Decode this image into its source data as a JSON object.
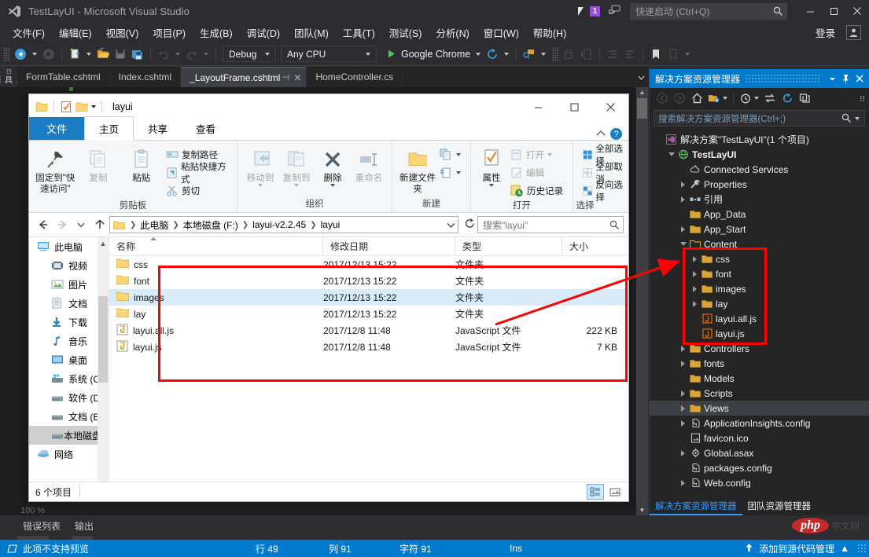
{
  "vs": {
    "title": "TestLayUI - Microsoft Visual Studio",
    "notification_count": "1",
    "quick_launch_placeholder": "快速启动 (Ctrl+Q)",
    "signin_label": "登录",
    "menus": [
      "文件(F)",
      "编辑(E)",
      "视图(V)",
      "项目(P)",
      "生成(B)",
      "调试(D)",
      "团队(M)",
      "工具(T)",
      "测试(S)",
      "分析(N)",
      "窗口(W)",
      "帮助(H)"
    ],
    "toolbar": {
      "config_combo": "Debug",
      "platform_combo": "Any CPU",
      "run_target": "Google Chrome"
    },
    "window_buttons": {
      "minimize": "—",
      "maximize": "□",
      "close": "✕"
    },
    "side_rail_label": "工具箱",
    "doc_tabs": [
      {
        "label": "FormTable.cshtml",
        "active": false
      },
      {
        "label": "Index.cshtml",
        "active": false
      },
      {
        "label": "_LayoutFrame.cshtml",
        "active": true
      },
      {
        "label": "HomeController.cs",
        "active": false
      }
    ],
    "editor_zoom": "100 %",
    "bottom_tabs": [
      "错误列表",
      "输出"
    ],
    "watermark": {
      "text": "php",
      "sub": "中文网"
    },
    "status_bar": {
      "message": "此项不支持预览",
      "line": "行 49",
      "column": "列 91",
      "chars": "字符 91",
      "insert_mode": "Ins",
      "source_control": "添加到源代码管理"
    }
  },
  "solution_explorer": {
    "title": "解决方案资源管理器",
    "search_placeholder": "搜索解决方案资源管理器(Ctrl+;)",
    "tree": [
      {
        "label": "解决方案\"TestLayUI\"(1 个项目)",
        "indent": 0,
        "icon": "solution-icon",
        "twisty": "none",
        "bold": false,
        "selected": false
      },
      {
        "label": "TestLayUI",
        "indent": 1,
        "icon": "project-web-icon",
        "twisty": "open",
        "bold": true,
        "selected": false
      },
      {
        "label": "Connected Services",
        "indent": 2,
        "icon": "cloud-icon",
        "twisty": "none",
        "bold": false,
        "selected": false
      },
      {
        "label": "Properties",
        "indent": 2,
        "icon": "wrench-icon",
        "twisty": "closed",
        "bold": false,
        "selected": false
      },
      {
        "label": "引用",
        "indent": 2,
        "icon": "references-icon",
        "twisty": "closed",
        "bold": false,
        "selected": false
      },
      {
        "label": "App_Data",
        "indent": 2,
        "icon": "folder-icon",
        "twisty": "none",
        "bold": false,
        "selected": false
      },
      {
        "label": "App_Start",
        "indent": 2,
        "icon": "folder-icon",
        "twisty": "closed",
        "bold": false,
        "selected": false
      },
      {
        "label": "Content",
        "indent": 2,
        "icon": "folder-open-icon",
        "twisty": "open",
        "bold": false,
        "selected": false
      },
      {
        "label": "css",
        "indent": 3,
        "icon": "folder-icon",
        "twisty": "closed",
        "bold": false,
        "selected": false
      },
      {
        "label": "font",
        "indent": 3,
        "icon": "folder-icon",
        "twisty": "closed",
        "bold": false,
        "selected": false
      },
      {
        "label": "images",
        "indent": 3,
        "icon": "folder-icon",
        "twisty": "closed",
        "bold": false,
        "selected": false
      },
      {
        "label": "lay",
        "indent": 3,
        "icon": "folder-icon",
        "twisty": "closed",
        "bold": false,
        "selected": false
      },
      {
        "label": "layui.all.js",
        "indent": 3,
        "icon": "js-file-icon",
        "twisty": "none",
        "bold": false,
        "selected": false
      },
      {
        "label": "layui.js",
        "indent": 3,
        "icon": "js-file-icon",
        "twisty": "none",
        "bold": false,
        "selected": false
      },
      {
        "label": "Controllers",
        "indent": 2,
        "icon": "folder-icon",
        "twisty": "closed",
        "bold": false,
        "selected": false
      },
      {
        "label": "fonts",
        "indent": 2,
        "icon": "folder-icon",
        "twisty": "closed",
        "bold": false,
        "selected": false
      },
      {
        "label": "Models",
        "indent": 2,
        "icon": "folder-icon",
        "twisty": "none",
        "bold": false,
        "selected": false
      },
      {
        "label": "Scripts",
        "indent": 2,
        "icon": "folder-icon",
        "twisty": "closed",
        "bold": false,
        "selected": false
      },
      {
        "label": "Views",
        "indent": 2,
        "icon": "folder-icon",
        "twisty": "closed",
        "bold": false,
        "selected": true
      },
      {
        "label": "ApplicationInsights.config",
        "indent": 2,
        "icon": "config-file-icon",
        "twisty": "closed",
        "bold": false,
        "selected": false
      },
      {
        "label": "favicon.ico",
        "indent": 2,
        "icon": "image-file-icon",
        "twisty": "none",
        "bold": false,
        "selected": false
      },
      {
        "label": "Global.asax",
        "indent": 2,
        "icon": "asax-file-icon",
        "twisty": "closed",
        "bold": false,
        "selected": false
      },
      {
        "label": "packages.config",
        "indent": 2,
        "icon": "config-file-icon",
        "twisty": "none",
        "bold": false,
        "selected": false
      },
      {
        "label": "Web.config",
        "indent": 2,
        "icon": "config-file-icon",
        "twisty": "closed",
        "bold": false,
        "selected": false
      }
    ],
    "footer_tabs": [
      {
        "label": "解决方案资源管理器",
        "active": true
      },
      {
        "label": "团队资源管理器",
        "active": false
      }
    ]
  },
  "explorer_window": {
    "title": "layui",
    "ribbon_tabs": [
      {
        "label": "文件",
        "kind": "file"
      },
      {
        "label": "主页",
        "kind": "active"
      },
      {
        "label": "共享",
        "kind": "normal"
      },
      {
        "label": "查看",
        "kind": "normal"
      }
    ],
    "ribbon_groups": [
      {
        "title": "剪贴板",
        "big": [
          {
            "label": "固定到\"快速访问\"",
            "icon": "pin-icon",
            "dim": false
          },
          {
            "label": "复制",
            "icon": "copy-icon",
            "dim": true
          },
          {
            "label": "粘贴",
            "icon": "paste-icon",
            "dim": false
          }
        ],
        "small": [
          {
            "label": "复制路径",
            "icon": "copy-path-icon",
            "dim": false
          },
          {
            "label": "粘贴快捷方式",
            "icon": "paste-shortcut-icon",
            "dim": false
          },
          {
            "label": "剪切",
            "icon": "scissors-icon",
            "dim": false
          }
        ]
      },
      {
        "title": "组织",
        "big": [
          {
            "label": "移动到",
            "icon": "move-to-icon",
            "dim": true
          },
          {
            "label": "复制到",
            "icon": "copy-to-icon",
            "dim": true
          },
          {
            "label": "删除",
            "icon": "delete-icon",
            "dim": false
          },
          {
            "label": "重命名",
            "icon": "rename-icon",
            "dim": true
          }
        ],
        "small": []
      },
      {
        "title": "新建",
        "big": [
          {
            "label": "新建文件夹",
            "icon": "new-folder-icon",
            "dim": false
          }
        ],
        "small": [
          {
            "label": "",
            "icon": "new-item-icon",
            "dim": false
          },
          {
            "label": "",
            "icon": "easy-access-icon",
            "dim": false
          }
        ]
      },
      {
        "title": "打开",
        "big": [
          {
            "label": "属性",
            "icon": "properties-icon",
            "dim": false
          }
        ],
        "small": [
          {
            "label": "打开",
            "icon": "open-icon",
            "dim": true
          },
          {
            "label": "编辑",
            "icon": "edit-icon",
            "dim": true
          },
          {
            "label": "历史记录",
            "icon": "history-icon",
            "dim": false
          }
        ]
      },
      {
        "title": "选择",
        "big": [],
        "small": [
          {
            "label": "全部选择",
            "icon": "select-all-icon",
            "dim": false
          },
          {
            "label": "全部取消",
            "icon": "select-none-icon",
            "dim": false
          },
          {
            "label": "反向选择",
            "icon": "invert-selection-icon",
            "dim": false
          }
        ]
      }
    ],
    "breadcrumbs": [
      "此电脑",
      "本地磁盘 (F:)",
      "layui-v2.2.45",
      "layui"
    ],
    "search_placeholder": "搜索\"layui\"",
    "nav_items": [
      {
        "label": "此电脑",
        "icon": "computer-icon",
        "indent": 0,
        "selected": false
      },
      {
        "label": "视频",
        "icon": "video-icon",
        "indent": 1,
        "selected": false
      },
      {
        "label": "图片",
        "icon": "picture-icon",
        "indent": 1,
        "selected": false
      },
      {
        "label": "文档",
        "icon": "document-icon",
        "indent": 1,
        "selected": false
      },
      {
        "label": "下载",
        "icon": "download-icon",
        "indent": 1,
        "selected": false
      },
      {
        "label": "音乐",
        "icon": "music-icon",
        "indent": 1,
        "selected": false
      },
      {
        "label": "桌面",
        "icon": "desktop-icon",
        "indent": 1,
        "selected": false
      },
      {
        "label": "系统 (C:)",
        "icon": "windows-drive-icon",
        "indent": 1,
        "selected": false
      },
      {
        "label": "软件 (D:)",
        "icon": "drive-icon",
        "indent": 1,
        "selected": false
      },
      {
        "label": "文档 (E:)",
        "icon": "drive-icon",
        "indent": 1,
        "selected": false
      },
      {
        "label": "本地磁盘 (F:)",
        "icon": "drive-icon",
        "indent": 1,
        "selected": true
      },
      {
        "label": "网络",
        "icon": "network-icon",
        "indent": 0,
        "selected": false
      }
    ],
    "columns": [
      "名称",
      "修改日期",
      "类型",
      "大小"
    ],
    "files": [
      {
        "name": "css",
        "date": "2017/12/13 15:22",
        "type": "文件夹",
        "size": "",
        "icon": "folder-icon",
        "selected": false
      },
      {
        "name": "font",
        "date": "2017/12/13 15:22",
        "type": "文件夹",
        "size": "",
        "icon": "folder-icon",
        "selected": false
      },
      {
        "name": "images",
        "date": "2017/12/13 15:22",
        "type": "文件夹",
        "size": "",
        "icon": "folder-icon",
        "selected": true
      },
      {
        "name": "lay",
        "date": "2017/12/13 15:22",
        "type": "文件夹",
        "size": "",
        "icon": "folder-icon",
        "selected": false
      },
      {
        "name": "layui.all.js",
        "date": "2017/12/8 11:48",
        "type": "JavaScript 文件",
        "size": "222 KB",
        "icon": "js-file-icon",
        "selected": false
      },
      {
        "name": "layui.js",
        "date": "2017/12/8 11:48",
        "type": "JavaScript 文件",
        "size": "7 KB",
        "icon": "js-file-icon",
        "selected": false
      }
    ],
    "status_text": "6 个项目"
  },
  "annotations": {
    "accent_color": "#ff0000",
    "boxes": 2,
    "arrow": "points from file list to solution explorer Content folder"
  }
}
